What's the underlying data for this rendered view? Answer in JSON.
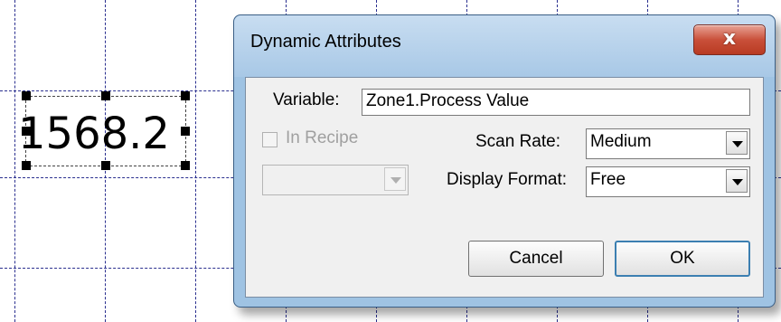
{
  "canvas": {
    "display_value": "1568.2"
  },
  "dialog": {
    "title": "Dynamic Attributes",
    "close_glyph": "x",
    "variable_label": "Variable:",
    "variable_value": "Zone1.Process Value",
    "in_recipe_label": "In Recipe",
    "in_recipe_checked": false,
    "recipe_select_value": "",
    "scan_rate_label": "Scan Rate:",
    "scan_rate_value": "Medium",
    "display_format_label": "Display Format:",
    "display_format_value": "Free",
    "cancel_label": "Cancel",
    "ok_label": "OK"
  },
  "icons": [
    "close-icon",
    "dropdown-arrow-icon"
  ],
  "colors": {
    "grid_line": "#2a2f8f",
    "dialog_frame": "#9fc3e3",
    "close_button": "#c9503a",
    "default_button_border": "#3c7fb1"
  }
}
